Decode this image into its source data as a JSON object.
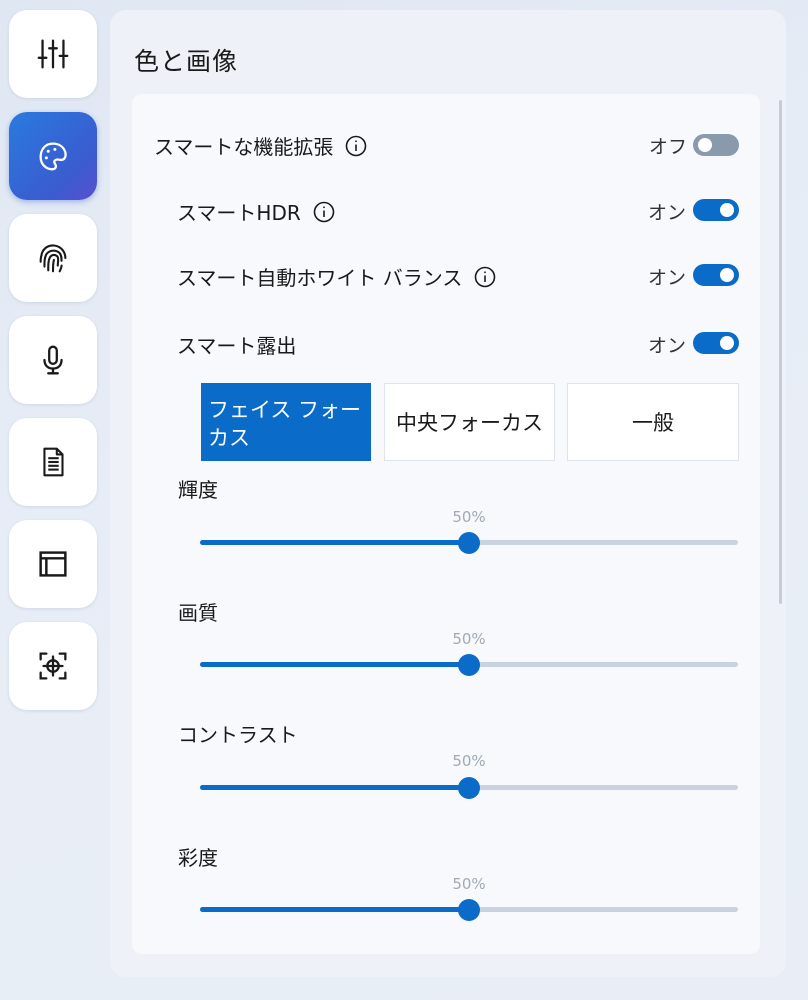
{
  "sidebar": {
    "items": [
      {
        "icon": "sliders-icon",
        "active": false
      },
      {
        "icon": "palette-icon",
        "active": true
      },
      {
        "icon": "fingerprint-icon",
        "active": false
      },
      {
        "icon": "microphone-icon",
        "active": false
      },
      {
        "icon": "document-icon",
        "active": false
      },
      {
        "icon": "window-layout-icon",
        "active": false
      },
      {
        "icon": "focus-crosshair-icon",
        "active": false
      }
    ]
  },
  "page": {
    "title": "色と画像"
  },
  "settings": {
    "smart_enhance": {
      "label": "スマートな機能拡張",
      "state": "オフ",
      "on": false
    },
    "smart_hdr": {
      "label": "スマートHDR",
      "state": "オン",
      "on": true
    },
    "smart_awb": {
      "label": "スマート自動ホワイト バランス",
      "state": "オン",
      "on": true
    },
    "smart_exposure": {
      "label": "スマート露出",
      "state": "オン",
      "on": true
    }
  },
  "exposure_modes": {
    "options": [
      "フェイス フォーカス",
      "中央フォーカス",
      "一般"
    ],
    "selected": "フェイス フォーカス"
  },
  "sliders": [
    {
      "label": "輝度",
      "value": 50,
      "value_text": "50%"
    },
    {
      "label": "画質",
      "value": 50,
      "value_text": "50%"
    },
    {
      "label": "コントラスト",
      "value": 50,
      "value_text": "50%"
    },
    {
      "label": "彩度",
      "value": 50,
      "value_text": "50%"
    }
  ],
  "colors": {
    "accent": "#0b6bc9",
    "toggle_off": "#8a9aad",
    "track": "#c9d3df"
  }
}
